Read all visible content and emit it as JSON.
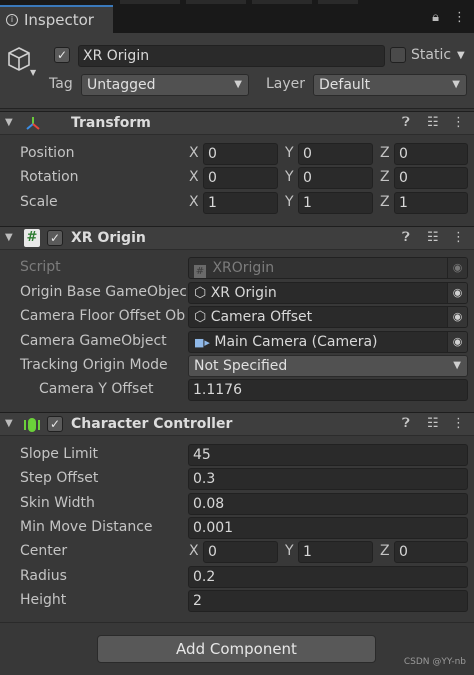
{
  "tab": {
    "label": "Inspector"
  },
  "gameobject": {
    "active": true,
    "name": "XR Origin",
    "static_label": "Static",
    "static_checked": false,
    "tag_label": "Tag",
    "tag_value": "Untagged",
    "layer_label": "Layer",
    "layer_value": "Default"
  },
  "transform": {
    "title": "Transform",
    "rows": [
      {
        "label": "Position",
        "x": "0",
        "y": "0",
        "z": "0"
      },
      {
        "label": "Rotation",
        "x": "0",
        "y": "0",
        "z": "0"
      },
      {
        "label": "Scale",
        "x": "1",
        "y": "1",
        "z": "1"
      }
    ],
    "axes": {
      "x": "X",
      "y": "Y",
      "z": "Z"
    }
  },
  "xr_origin": {
    "title": "XR Origin",
    "enabled": true,
    "script_label": "Script",
    "script_value": "XROrigin",
    "origin_label": "Origin Base GameObjec",
    "origin_value": "XR Origin",
    "floor_label": "Camera Floor Offset Ob",
    "floor_value": "Camera Offset",
    "camera_label": "Camera GameObject",
    "camera_value": "Main Camera (Camera)",
    "tracking_label": "Tracking Origin Mode",
    "tracking_value": "Not Specified",
    "yoffset_label": "Camera Y Offset",
    "yoffset_value": "1.1176"
  },
  "character_controller": {
    "title": "Character Controller",
    "enabled": true,
    "slope_label": "Slope Limit",
    "slope_value": "45",
    "step_label": "Step Offset",
    "step_value": "0.3",
    "skin_label": "Skin Width",
    "skin_value": "0.08",
    "minmove_label": "Min Move Distance",
    "minmove_value": "0.001",
    "center_label": "Center",
    "center_x": "0",
    "center_y": "1",
    "center_z": "0",
    "radius_label": "Radius",
    "radius_value": "0.2",
    "height_label": "Height",
    "height_value": "2"
  },
  "add_component_label": "Add Component",
  "watermark": "CSDN @YY-nb",
  "colors": {
    "accent": "#3a79bb",
    "panel": "#383838",
    "field": "#2a2a2a"
  }
}
